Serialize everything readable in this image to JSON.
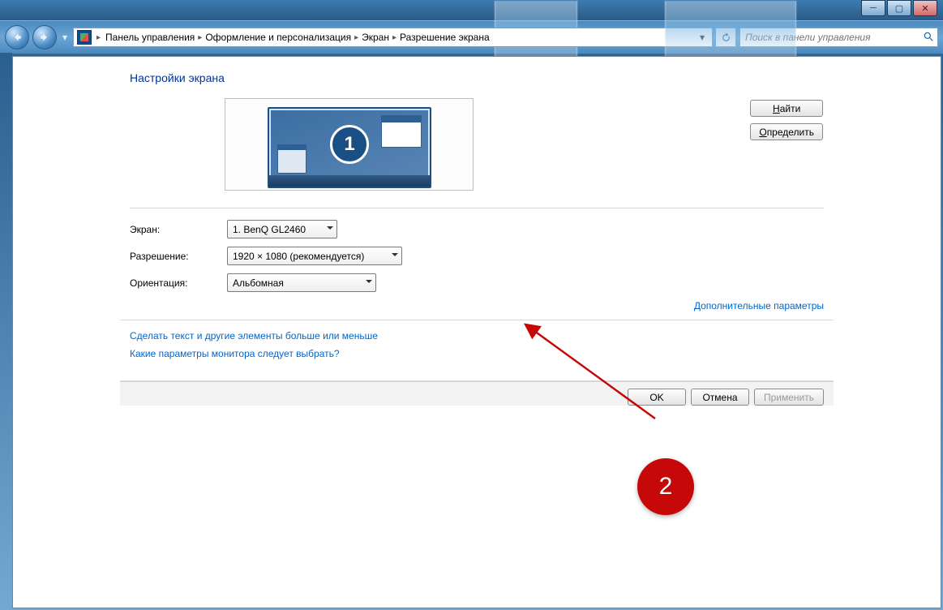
{
  "window": {
    "minimize_glyph": "─",
    "maximize_glyph": "▢",
    "close_glyph": "✕"
  },
  "breadcrumbs": {
    "items": [
      "Панель управления",
      "Оформление и персонализация",
      "Экран",
      "Разрешение экрана"
    ],
    "sep": "▸"
  },
  "search": {
    "placeholder": "Поиск в панели управления"
  },
  "page": {
    "heading": "Настройки экрана",
    "monitor_number": "1",
    "detect_btn": "Найти",
    "detect_accel": "Н",
    "identify_btn": "Определить",
    "identify_accel": "О",
    "labels": {
      "screen": "Экран:",
      "resolution": "Разрешение:",
      "orientation": "Ориентация:"
    },
    "values": {
      "screen": "1. BenQ GL2460",
      "resolution": "1920 × 1080 (рекомендуется)",
      "orientation": "Альбомная"
    },
    "advanced_link": "Дополнительные параметры",
    "help1": "Сделать текст и другие элементы больше или меньше",
    "help2": "Какие параметры монитора следует выбрать?",
    "ok": "OK",
    "cancel": "Отмена",
    "apply": "Применить"
  },
  "annotation": {
    "label": "2"
  }
}
